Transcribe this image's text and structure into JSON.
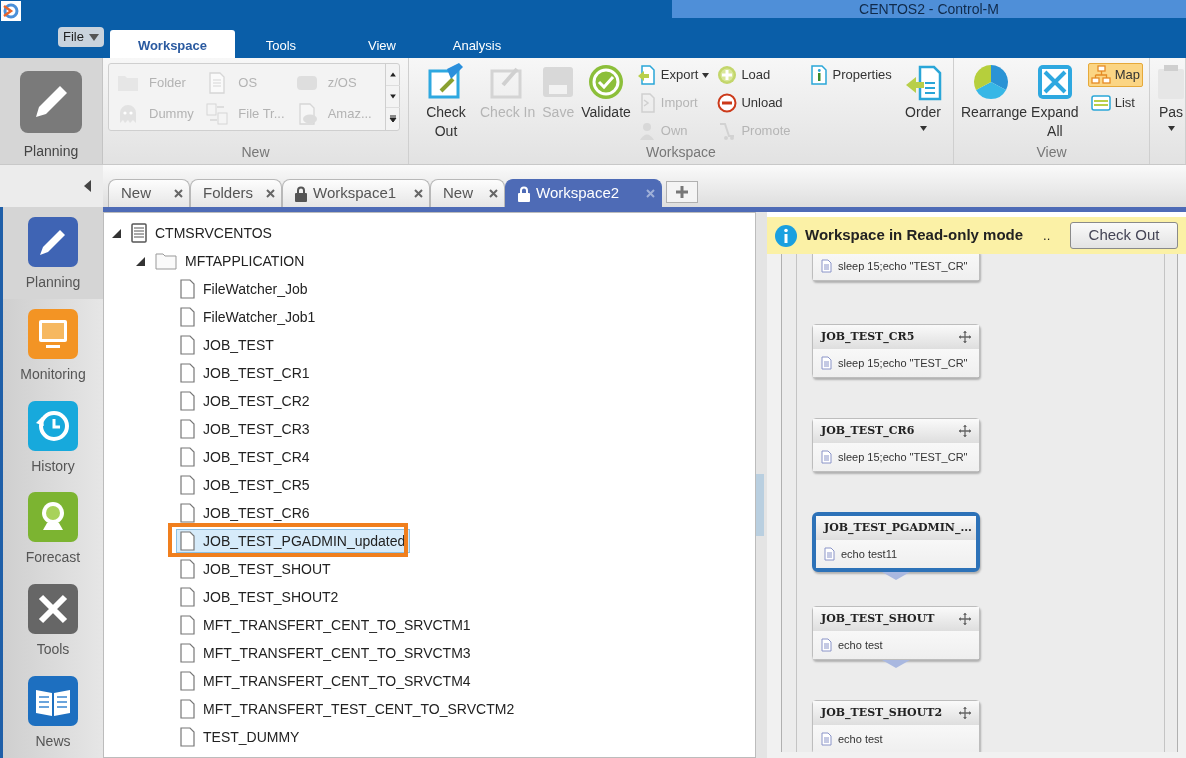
{
  "window": {
    "title": "CENTOS2 - Control-M"
  },
  "file_menu": {
    "label": "File"
  },
  "ribbon_tabs": [
    {
      "label": "Workspace",
      "selected": true
    },
    {
      "label": "Tools",
      "selected": false
    },
    {
      "label": "View",
      "selected": false
    },
    {
      "label": "Analysis",
      "selected": false
    }
  ],
  "ribbon": {
    "domain": {
      "label": "Planning"
    },
    "groups": [
      {
        "title": "New",
        "kind": "gallery",
        "items": [
          {
            "label": "Folder",
            "disabled": true
          },
          {
            "label": "OS",
            "disabled": true
          },
          {
            "label": "z/OS",
            "disabled": true
          },
          {
            "label": "Dummy",
            "disabled": true
          },
          {
            "label": "File Tr...",
            "disabled": true
          },
          {
            "label": "Amaz...",
            "disabled": true
          }
        ]
      },
      {
        "title": "Workspace",
        "kind": "controls",
        "controls": [
          {
            "kind": "large",
            "label": "Check Out",
            "disabled": false
          },
          {
            "kind": "large",
            "label": "Check In",
            "disabled": true
          },
          {
            "kind": "large",
            "label": "Save",
            "disabled": true
          },
          {
            "kind": "large",
            "label": "Validate",
            "disabled": false
          },
          {
            "kind": "stack",
            "items": [
              {
                "label": "Export",
                "disabled": false,
                "dropdown": true
              },
              {
                "label": "Import",
                "disabled": true,
                "dropdown": false
              },
              {
                "label": "Own",
                "disabled": true,
                "dropdown": false
              }
            ]
          },
          {
            "kind": "stack",
            "items": [
              {
                "label": "Load",
                "disabled": false,
                "dropdown": false
              },
              {
                "label": "Unload",
                "disabled": false,
                "dropdown": false
              },
              {
                "label": "Promote",
                "disabled": true,
                "dropdown": false
              }
            ]
          },
          {
            "kind": "stack",
            "items": [
              {
                "label": "Properties",
                "disabled": false,
                "dropdown": false
              }
            ]
          },
          {
            "kind": "large",
            "label": "Order",
            "disabled": false,
            "dropdown": true
          }
        ]
      },
      {
        "title": "View",
        "kind": "controls",
        "controls": [
          {
            "kind": "large",
            "label": "Rearrange",
            "disabled": false
          },
          {
            "kind": "large",
            "label": "Expand All",
            "disabled": false
          },
          {
            "kind": "stack",
            "items": [
              {
                "label": "Map",
                "disabled": false,
                "dropdown": false,
                "selected": true
              },
              {
                "label": "List",
                "disabled": false,
                "dropdown": false,
                "selected": false
              }
            ]
          }
        ]
      },
      {
        "kind": "controls",
        "controls": [
          {
            "kind": "large",
            "label": "Pas",
            "disabled": false,
            "dropdown": true
          }
        ]
      }
    ]
  },
  "doc_tabs": [
    {
      "label": "New",
      "locked": false,
      "selected": false
    },
    {
      "label": "Folders",
      "locked": false,
      "selected": false
    },
    {
      "label": "Workspace1",
      "locked": true,
      "selected": false
    },
    {
      "label": "New",
      "locked": false,
      "selected": false
    },
    {
      "label": "Workspace2",
      "locked": true,
      "selected": true
    }
  ],
  "nav": [
    {
      "label": "Planning",
      "selected": true
    },
    {
      "label": "Monitoring",
      "selected": false
    },
    {
      "label": "History",
      "selected": false
    },
    {
      "label": "Forecast",
      "selected": false
    },
    {
      "label": "Tools",
      "selected": false
    },
    {
      "label": "News",
      "selected": false
    }
  ],
  "tree": [
    {
      "label": "CTMSRVCENTOS",
      "expanded": true,
      "children": [
        {
          "label": "MFTAPPLICATION",
          "expanded": true,
          "children": [
            {
              "label": "FileWatcher_Job",
              "selected": false
            },
            {
              "label": "FileWatcher_Job1",
              "selected": false
            },
            {
              "label": "JOB_TEST",
              "selected": false
            },
            {
              "label": "JOB_TEST_CR1",
              "selected": false
            },
            {
              "label": "JOB_TEST_CR2",
              "selected": false
            },
            {
              "label": "JOB_TEST_CR3",
              "selected": false
            },
            {
              "label": "JOB_TEST_CR4",
              "selected": false
            },
            {
              "label": "JOB_TEST_CR5",
              "selected": false
            },
            {
              "label": "JOB_TEST_CR6",
              "selected": false
            },
            {
              "label": "JOB_TEST_PGADMIN_updated",
              "selected": true
            },
            {
              "label": "JOB_TEST_SHOUT",
              "selected": false
            },
            {
              "label": "JOB_TEST_SHOUT2",
              "selected": false
            },
            {
              "label": "MFT_TRANSFERT_CENT_TO_SRVCTM1",
              "selected": false
            },
            {
              "label": "MFT_TRANSFERT_CENT_TO_SRVCTM3",
              "selected": false
            },
            {
              "label": "MFT_TRANSFERT_CENT_TO_SRVCTM4",
              "selected": false
            },
            {
              "label": "MFT_TRANSFERT_TEST_CENT_TO_SRVCTM2",
              "selected": false
            },
            {
              "label": "TEST_DUMMY",
              "selected": false
            }
          ]
        }
      ]
    }
  ],
  "banner": {
    "text": "Workspace in Read-only mode",
    "more": "..",
    "button": "Check Out"
  },
  "map_nodes": [
    {
      "command": "sleep 15;echo \"TEST_CR\"",
      "selected": false,
      "connected": false
    },
    {
      "title": "JOB_TEST_CR5",
      "command": "sleep 15;echo \"TEST_CR\"",
      "selected": false,
      "connected": false
    },
    {
      "title": "JOB_TEST_CR6",
      "command": "sleep 15;echo \"TEST_CR\"",
      "selected": false,
      "connected": false
    },
    {
      "title": "JOB_TEST_PGADMIN_...",
      "command": "echo test11",
      "selected": true,
      "connected": true
    },
    {
      "title": "JOB_TEST_SHOUT",
      "command": "echo test",
      "selected": false,
      "connected": true
    },
    {
      "title": "JOB_TEST_SHOUT2",
      "command": "echo test",
      "selected": false,
      "connected": false
    }
  ]
}
